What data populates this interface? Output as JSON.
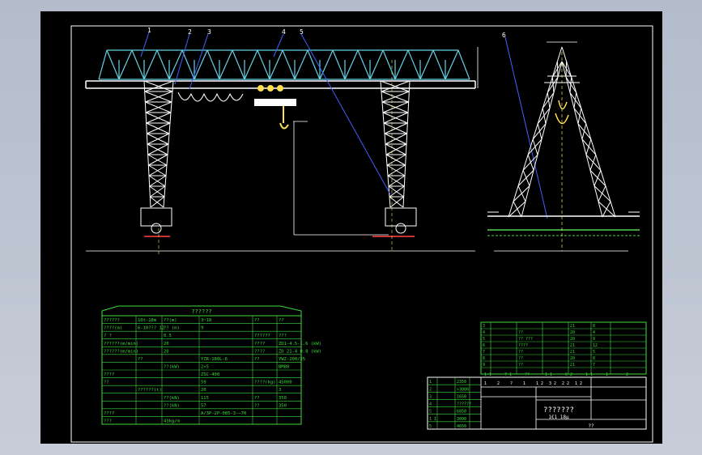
{
  "title_block": {
    "drawing_title": "???????",
    "scale_note": "1€1   18μ",
    "sheet_label": "??",
    "rev_row": [
      "1",
      "2",
      "?",
      "1",
      "1 2",
      "3 2",
      "2 2",
      "1 2"
    ]
  },
  "callouts": [
    "1",
    "2",
    "3",
    "4",
    "5",
    "6"
  ],
  "spec_table": {
    "title": "??????",
    "rows": [
      [
        "??????",
        "10t-18m",
        "??(m)",
        "3~18",
        "??",
        "??"
      ],
      [
        "????(m)",
        "6-10??? 12",
        "?? (m)",
        "9",
        "",
        ""
      ],
      [
        "?  ?",
        "",
        "0.5",
        "",
        "??????",
        "???"
      ],
      [
        "??????(m/min)",
        "",
        "20",
        "",
        "????",
        "ZD1-4.5-1.6 (kW)"
      ],
      [
        "??????(m/min)",
        "",
        "20",
        "",
        "????",
        "ZD 21-4 0.8 (kW)"
      ],
      [
        "",
        "??",
        "",
        "YZR-180L-6",
        "??",
        "YWZ-200/25"
      ],
      [
        "",
        "",
        "??(kW)",
        "2×5",
        "",
        "BM80"
      ],
      [
        "????",
        "",
        "",
        "ZSC-400",
        "",
        ""
      ],
      [
        "??",
        "",
        "",
        "59",
        "????(kg)",
        "45000"
      ],
      [
        "",
        "??????(t)",
        "",
        "20",
        "",
        "3"
      ],
      [
        "",
        "",
        "??(kN)",
        "115",
        "??",
        "350"
      ],
      [
        "",
        "",
        "??(kN)",
        "57",
        "??",
        "350"
      ],
      [
        "????",
        "",
        "",
        "A/3P-2P-085-3-−70",
        ""
      ],
      [
        "???",
        "",
        "43kg/m",
        "",
        "",
        ""
      ]
    ]
  },
  "parts_table": {
    "header": [
      "1 1",
      "7 1",
      "??",
      "1 1",
      "6 2",
      "1 1",
      "1",
      "2"
    ],
    "rows": [
      [
        "3",
        "",
        "",
        "",
        "21",
        "8"
      ],
      [
        "4",
        "",
        "??",
        "",
        "20",
        "4"
      ],
      [
        "5",
        "",
        "?? ???",
        "",
        "20",
        "9"
      ],
      [
        "6",
        "",
        "????",
        "",
        "21",
        "12"
      ],
      [
        "7",
        "",
        "??",
        "",
        "21",
        "5"
      ],
      [
        "8",
        "",
        "??",
        "",
        "20",
        "8"
      ],
      [
        "9",
        "",
        "??",
        "",
        "21",
        "7"
      ]
    ]
  },
  "small_table": {
    "rows": [
      [
        "1",
        "",
        "2350",
        "",
        ""
      ],
      [
        "2",
        "",
        ">3000",
        "",
        ""
      ],
      [
        "3",
        "",
        "1650",
        "",
        ""
      ],
      [
        "4",
        "",
        "??????",
        "",
        ""
      ],
      [
        "5",
        "",
        "6850",
        "",
        ""
      ],
      [
        "1 1",
        "",
        "3000",
        "",
        ""
      ],
      [
        "5",
        "",
        "4650",
        "",
        ""
      ]
    ]
  },
  "colors": {
    "truss": "#64d2e6",
    "leg": "#ffffff",
    "hoist": "#ffe050",
    "rail_green": "#50d250",
    "ground": "#c83232",
    "leader": "#4060ff",
    "table_green": "#3cdc3c",
    "border": "#ffffff",
    "dimension": "#ffffff"
  }
}
